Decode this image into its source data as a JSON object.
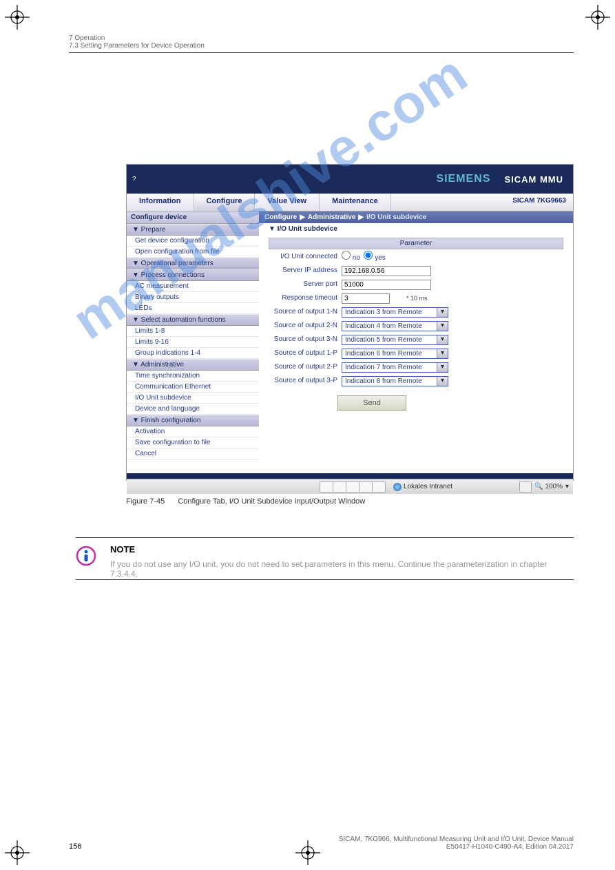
{
  "header": {
    "chapter": "7 Operation",
    "section": "7.3 Setting Parameters for Device Operation"
  },
  "watermark": "manualshive.com",
  "screenshot": {
    "brand": "SIEMENS",
    "product": "SICAM MMU",
    "device": "SICAM 7KG9663",
    "help_icon": "?",
    "tabs": {
      "information": "Information",
      "configure": "Configure",
      "value_view": "Value View",
      "maintenance": "Maintenance"
    },
    "side": {
      "title": "Configure device",
      "sec_prepare": "▼ Prepare",
      "get_device": "Get device configuration",
      "open_config": "Open configuration from file",
      "sec_operational": "▼ Operational parameters",
      "sec_process": "▼ Process connections",
      "ac_meas": "AC measurement",
      "binary_out": "Binary outputs",
      "leds": "LEDs",
      "sec_auto": "▼ Select automation functions",
      "limits18": "Limits 1-8",
      "limits916": "Limits 9-16",
      "group14": "Group indications 1-4",
      "sec_admin": "▼ Administrative",
      "time_sync": "Time synchronization",
      "comm_eth": "Communication Ethernet",
      "io_sub": "I/O Unit subdevice",
      "dev_lang": "Device and language",
      "sec_finish": "▼ Finish configuration",
      "activation": "Activation",
      "save_file": "Save configuration to file",
      "cancel": "Cancel"
    },
    "crumb": {
      "a": "Configure",
      "b": "Administrative",
      "c": "I/O Unit subdevice"
    },
    "subhdr": "▼ I/O Unit subdevice",
    "form": {
      "param_hdr": "Parameter",
      "io_conn_lbl": "I/O Unit connected",
      "no": "no",
      "yes": "yes",
      "ip_lbl": "Server IP address",
      "ip_val": "192.168.0.56",
      "port_lbl": "Server port",
      "port_val": "51000",
      "timeout_lbl": "Response timeout",
      "timeout_val": "3",
      "timeout_note": "* 10 ms",
      "out1n_lbl": "Source of output 1-N",
      "out1n_val": "Indication 3 from Remote",
      "out2n_lbl": "Source of output 2-N",
      "out2n_val": "Indication 4 from Remote",
      "out3n_lbl": "Source of output 3-N",
      "out3n_val": "Indication 5 from Remote",
      "out1p_lbl": "Source of output 1-P",
      "out1p_val": "Indication 6 from Remote",
      "out2p_lbl": "Source of output 2-P",
      "out2p_val": "Indication 7 from Remote",
      "out3p_lbl": "Source of output 3-P",
      "out3p_val": "Indication 8 from Remote",
      "send": "Send"
    },
    "status": {
      "intranet": "Lokales Intranet",
      "zoom": "100%"
    }
  },
  "caption": {
    "num": "Figure 7-45",
    "text": "Configure Tab, I/O Unit Subdevice Input/Output Window"
  },
  "note": {
    "label": "NOTE",
    "text": "If you do not use any I/O unit, you do not need to set parameters in this menu. Continue the parameterization in chapter 7.3.4.4."
  },
  "footer": {
    "page": "156",
    "line1": "SICAM, 7KG966, Multifunctional Measuring Unit and I/O Unit, Device Manual",
    "line2": "E50417-H1040-C490-A4, Edition 04.2017"
  }
}
